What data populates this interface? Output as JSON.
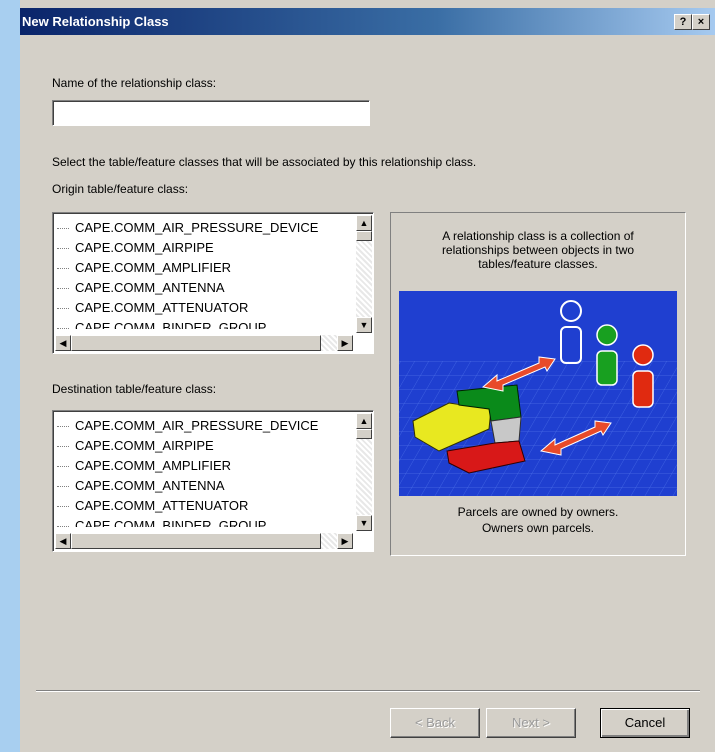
{
  "window": {
    "title": "New Relationship Class",
    "help_button": "?",
    "close_button": "×"
  },
  "name_field": {
    "label": "Name of the relationship class:",
    "value": ""
  },
  "instructions": "Select the table/feature classes that will be associated by this relationship class.",
  "origin": {
    "label": "Origin table/feature class:",
    "items": [
      "CAPE.COMM_AIR_PRESSURE_DEVICE",
      "CAPE.COMM_AIRPIPE",
      "CAPE.COMM_AMPLIFIER",
      "CAPE.COMM_ANTENNA",
      "CAPE.COMM_ATTENUATOR",
      "CAPE.COMM_BINDER_GROUP"
    ]
  },
  "destination": {
    "label": "Destination table/feature class:",
    "items": [
      "CAPE.COMM_AIR_PRESSURE_DEVICE",
      "CAPE.COMM_AIRPIPE",
      "CAPE.COMM_AMPLIFIER",
      "CAPE.COMM_ANTENNA",
      "CAPE.COMM_ATTENUATOR",
      "CAPE.COMM_BINDER_GROUP"
    ]
  },
  "info_panel": {
    "description": "A relationship class is a collection of relationships between objects in two tables/feature classes.",
    "caption_line1": "Parcels are owned by owners.",
    "caption_line2": "Owners own parcels."
  },
  "buttons": {
    "back": "< Back",
    "next": "Next >",
    "cancel": "Cancel"
  },
  "colors": {
    "titlebar": "#0a246a",
    "dialog_bg": "#d4d0c8",
    "desktop_bg": "#a8cff0",
    "illustration_bg": "#1f3fd0",
    "arrow": "#e84a2a"
  }
}
